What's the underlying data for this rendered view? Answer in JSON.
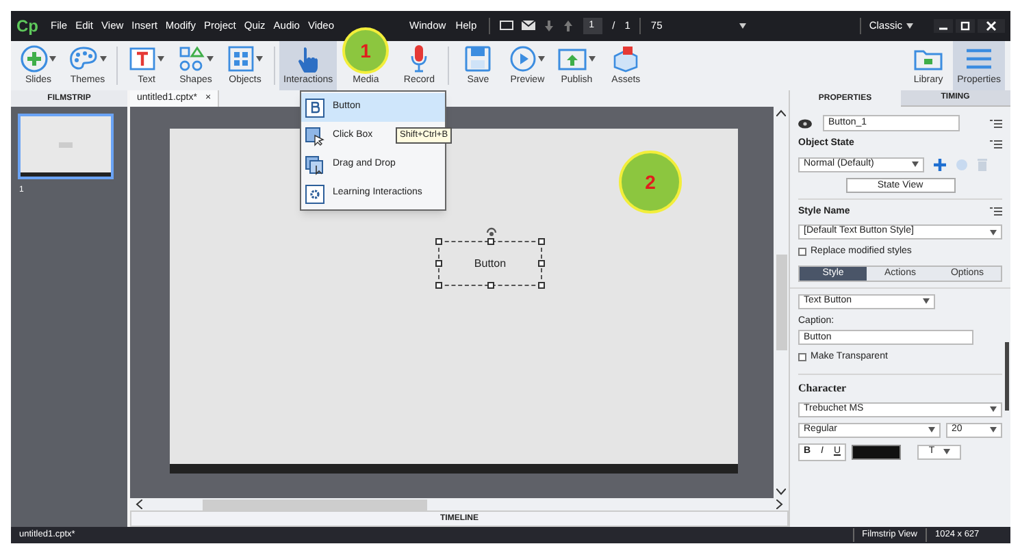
{
  "app": {
    "logo": "Cp"
  },
  "menu": [
    "File",
    "Edit",
    "View",
    "Insert",
    "Modify",
    "Project",
    "Quiz",
    "Audio",
    "Video"
  ],
  "menu_after_callout": [
    "Window",
    "Help"
  ],
  "page": {
    "current": "1",
    "separator": "/",
    "total": "1",
    "zoom": "75"
  },
  "workspace": "Classic",
  "toolbar_groups": [
    {
      "buttons": [
        {
          "label": "Slides",
          "kind": "slides",
          "caret": true,
          "selected": false
        },
        {
          "label": "Themes",
          "kind": "themes",
          "caret": true,
          "selected": false
        }
      ]
    },
    {
      "buttons": [
        {
          "label": "Text",
          "kind": "text",
          "caret": true,
          "selected": false
        },
        {
          "label": "Shapes",
          "kind": "shapes",
          "caret": true,
          "selected": false
        },
        {
          "label": "Objects",
          "kind": "objects",
          "caret": true,
          "selected": false
        }
      ]
    },
    {
      "buttons": [
        {
          "label": "Interactions",
          "kind": "interactions",
          "caret": false,
          "selected": true
        },
        {
          "label": "Media",
          "kind": "covered",
          "selected": false
        },
        {
          "label": "Record",
          "kind": "record",
          "caret": false,
          "selected": false
        }
      ]
    },
    {
      "buttons": [
        {
          "label": "Save",
          "kind": "save",
          "caret": false,
          "selected": false
        },
        {
          "label": "Preview",
          "kind": "preview",
          "caret": true,
          "selected": false
        },
        {
          "label": "Publish",
          "kind": "publish",
          "caret": true,
          "selected": false
        },
        {
          "label": "Assets",
          "kind": "assets",
          "caret": false,
          "selected": false
        }
      ]
    },
    {
      "buttons": [
        {
          "label": "Library",
          "kind": "library",
          "caret": false,
          "selected": false
        },
        {
          "label": "Properties",
          "kind": "properties",
          "caret": false,
          "selected": true
        }
      ]
    }
  ],
  "callouts": [
    "1",
    "2"
  ],
  "filmstrip": {
    "title": "FILMSTRIP",
    "slides": [
      {
        "number": "1",
        "selected": true
      }
    ]
  },
  "document_tab": {
    "label": "untitled1.cptx*",
    "close": "×"
  },
  "stage": {
    "object": {
      "label": "Button",
      "selected": true
    }
  },
  "interactions_menu": [
    {
      "label": "Button",
      "kind": "button",
      "highlighted": true
    },
    {
      "label": "Click Box",
      "kind": "clickbox",
      "highlighted": false
    },
    {
      "label": "Drag and Drop",
      "kind": "dragdrop",
      "highlighted": false
    },
    {
      "label": "Learning Interactions",
      "kind": "learning",
      "highlighted": false
    }
  ],
  "tooltip": "Shift+Ctrl+B",
  "timeline": "TIMELINE",
  "panel": {
    "tabs": [
      {
        "label": "PROPERTIES",
        "selected": true
      },
      {
        "label": "TIMING",
        "selected": false
      }
    ],
    "name": "Button_1",
    "object_state": {
      "title": "Object State",
      "value": "Normal (Default)",
      "button": "State View"
    },
    "style_name": {
      "title": "Style Name",
      "value": "[Default Text Button Style]",
      "checkbox": {
        "label": "Replace modified styles",
        "checked": false
      }
    },
    "subtabs": [
      {
        "label": "Style",
        "selected": true
      },
      {
        "label": "Actions",
        "selected": false
      },
      {
        "label": "Options",
        "selected": false
      }
    ],
    "button_type": "Text Button",
    "caption_label": "Caption:",
    "caption": "Button",
    "transparent": {
      "label": "Make Transparent",
      "checked": false
    },
    "character": {
      "title": "Character",
      "font": "Trebuchet MS",
      "style": "Regular",
      "size": "20",
      "format": [
        "B",
        "I",
        "U"
      ],
      "color": "#111111",
      "text_menu": "T"
    }
  },
  "status_bar": {
    "file": "untitled1.cptx*",
    "view": "Filmstrip View",
    "size": "1024 x 627"
  }
}
